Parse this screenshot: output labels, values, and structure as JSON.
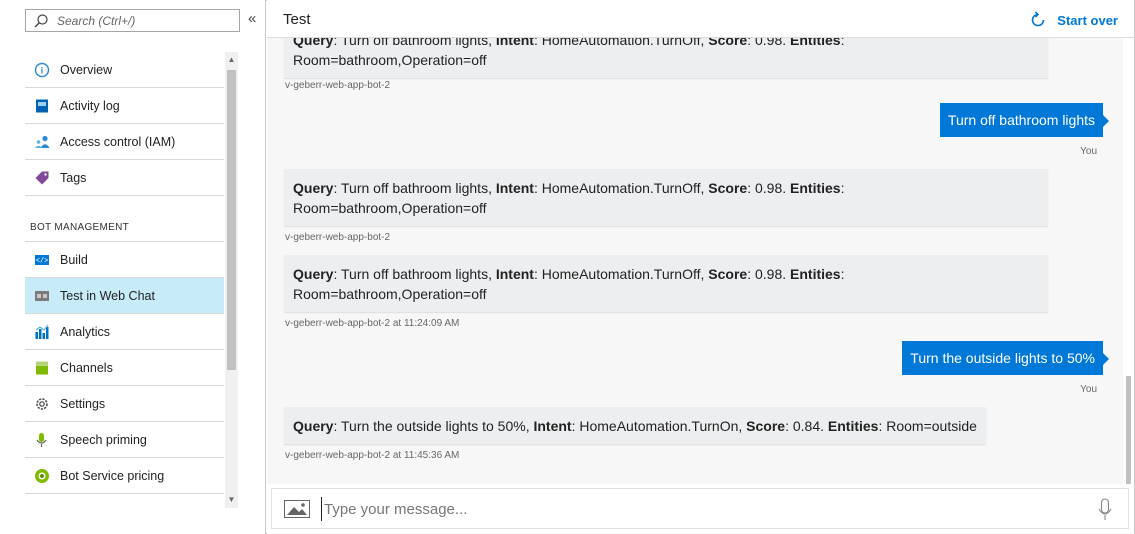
{
  "sidebar": {
    "search_placeholder": "Search (Ctrl+/)",
    "collapse_glyph": "«",
    "items": [
      {
        "label": "Overview",
        "icon": "overview-icon"
      },
      {
        "label": "Activity log",
        "icon": "activity-log-icon"
      },
      {
        "label": "Access control (IAM)",
        "icon": "access-control-icon"
      },
      {
        "label": "Tags",
        "icon": "tag-icon"
      }
    ],
    "section_label": "BOT MANAGEMENT",
    "bot_items": [
      {
        "label": "Build",
        "icon": "code-icon"
      },
      {
        "label": "Test in Web Chat",
        "icon": "webchat-icon",
        "active": true
      },
      {
        "label": "Analytics",
        "icon": "analytics-icon"
      },
      {
        "label": "Channels",
        "icon": "channels-icon"
      },
      {
        "label": "Settings",
        "icon": "gear-icon"
      },
      {
        "label": "Speech priming",
        "icon": "speech-icon"
      },
      {
        "label": "Bot Service pricing",
        "icon": "pricing-icon"
      }
    ]
  },
  "chat": {
    "title": "Test",
    "start_over": "Start over",
    "messages": [
      {
        "from": "bot",
        "query": "Turn off bathroom lights",
        "intent": "HomeAutomation.TurnOff",
        "score": "0.98",
        "entities": "Room=bathroom,Operation=off",
        "meta": "v-geberr-web-app-bot-2"
      },
      {
        "from": "user",
        "text": "Turn off bathroom lights",
        "meta": "You"
      },
      {
        "from": "bot",
        "query": "Turn off bathroom lights",
        "intent": "HomeAutomation.TurnOff",
        "score": "0.98",
        "entities": "Room=bathroom,Operation=off",
        "meta": "v-geberr-web-app-bot-2"
      },
      {
        "from": "bot",
        "query": "Turn off bathroom lights",
        "intent": "HomeAutomation.TurnOff",
        "score": "0.98",
        "entities": "Room=bathroom,Operation=off",
        "meta": "v-geberr-web-app-bot-2 at 11:24:09 AM"
      },
      {
        "from": "user",
        "text": "Turn the outside lights to 50%",
        "meta": "You"
      },
      {
        "from": "bot",
        "query": "Turn the outside lights to 50%",
        "intent": "HomeAutomation.TurnOn",
        "score": "0.84",
        "entities": "Room=outside",
        "meta": "v-geberr-web-app-bot-2 at 11:45:36 AM"
      }
    ],
    "labels": {
      "query": "Query",
      "intent": "Intent",
      "score": "Score",
      "entities": "Entities"
    },
    "composer_placeholder": "Type your message..."
  },
  "colors": {
    "accent": "#0078d7",
    "active_nav": "#c7ecf7",
    "bot_bubble": "#eceef0"
  }
}
